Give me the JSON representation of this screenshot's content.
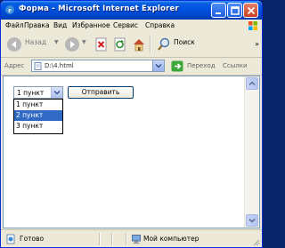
{
  "window": {
    "title": "Форма - Microsoft Internet Explorer"
  },
  "menu": {
    "items": [
      "Файл",
      "Правка",
      "Вид",
      "Избранное",
      "Сервис",
      "Справка"
    ]
  },
  "toolbar": {
    "back_label": "Назад",
    "search_label": "Поиск"
  },
  "address": {
    "label": "Адрес",
    "value": "D:\\4.html",
    "go_label": "Переход",
    "links_label": "Ссылки"
  },
  "form": {
    "select_value": "1 пункт",
    "options": [
      "1 пункт",
      "2 пункт",
      "3 пункт"
    ],
    "highlighted_option": "2 пункт",
    "submit_label": "Отправить"
  },
  "status": {
    "text": "Готово",
    "zone": "Мой компьютер"
  },
  "colors": {
    "title_bar": "#0054e3",
    "selection": "#316ac5",
    "chrome": "#ece9d8"
  }
}
